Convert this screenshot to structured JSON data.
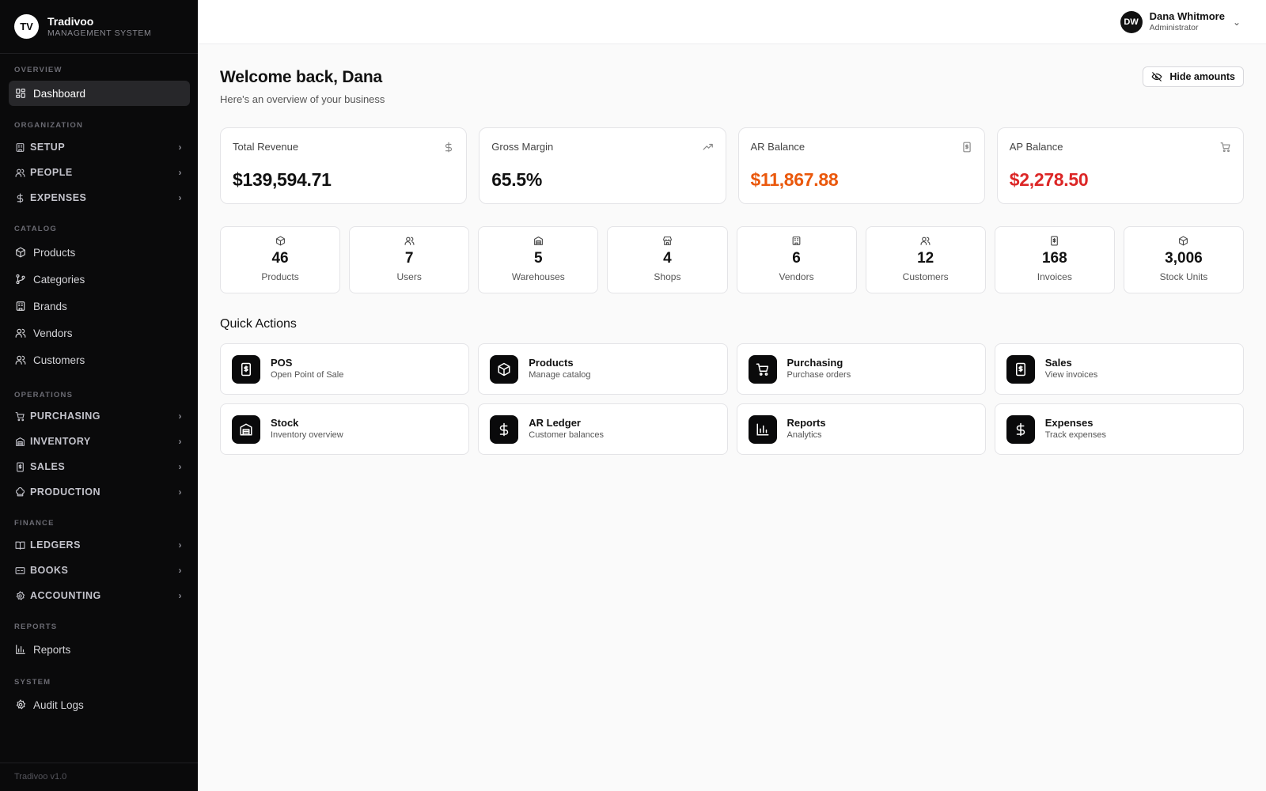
{
  "brand": {
    "logo": "TV",
    "name": "Tradivoo",
    "subtitle": "MANAGEMENT SYSTEM",
    "version": "Tradivoo v1.0"
  },
  "sidebar": {
    "sections": [
      "OVERVIEW",
      "ORGANIZATION",
      "CATALOG",
      "OPERATIONS",
      "FINANCE",
      "REPORTS",
      "SYSTEM"
    ],
    "items": [
      {
        "label": "Dashboard",
        "icon": "grid-icon"
      },
      {
        "label": "SETUP",
        "icon": "building-icon"
      },
      {
        "label": "PEOPLE",
        "icon": "users-icon"
      },
      {
        "label": "EXPENSES",
        "icon": "dollar-icon"
      },
      {
        "label": "Products",
        "icon": "box-icon"
      },
      {
        "label": "Categories",
        "icon": "branch-icon"
      },
      {
        "label": "Brands",
        "icon": "building-icon"
      },
      {
        "label": "Vendors",
        "icon": "users-icon"
      },
      {
        "label": "Customers",
        "icon": "users-icon"
      },
      {
        "label": "PURCHASING",
        "icon": "cart-icon"
      },
      {
        "label": "INVENTORY",
        "icon": "warehouse-icon"
      },
      {
        "label": "SALES",
        "icon": "receipt-icon"
      },
      {
        "label": "PRODUCTION",
        "icon": "chef-hat-icon"
      },
      {
        "label": "LEDGERS",
        "icon": "book-icon"
      },
      {
        "label": "BOOKS",
        "icon": "card-icon"
      },
      {
        "label": "ACCOUNTING",
        "icon": "gear-icon"
      },
      {
        "label": "Reports",
        "icon": "bar-chart-icon"
      },
      {
        "label": "Audit Logs",
        "icon": "gear-icon"
      }
    ]
  },
  "user": {
    "initials": "DW",
    "name": "Dana Whitmore",
    "role": "Administrator"
  },
  "header": {
    "welcome": "Welcome back, Dana",
    "subtitle": "Here's an overview of your business",
    "hide_amounts": "Hide amounts"
  },
  "kpis": [
    {
      "label": "Total Revenue",
      "value": "$139,594.71",
      "icon": "dollar-icon"
    },
    {
      "label": "Gross Margin",
      "value": "65.5%",
      "icon": "trending-up-icon"
    },
    {
      "label": "AR Balance",
      "value": "$11,867.88",
      "icon": "receipt-icon",
      "color": "#ea580c"
    },
    {
      "label": "AP Balance",
      "value": "$2,278.50",
      "icon": "cart-icon",
      "color": "#dc2626"
    }
  ],
  "stats": [
    {
      "value": "46",
      "label": "Products",
      "icon": "box-icon"
    },
    {
      "value": "7",
      "label": "Users",
      "icon": "users-icon"
    },
    {
      "value": "5",
      "label": "Warehouses",
      "icon": "warehouse-icon"
    },
    {
      "value": "4",
      "label": "Shops",
      "icon": "store-icon"
    },
    {
      "value": "6",
      "label": "Vendors",
      "icon": "building-icon"
    },
    {
      "value": "12",
      "label": "Customers",
      "icon": "users-icon"
    },
    {
      "value": "168",
      "label": "Invoices",
      "icon": "receipt-icon"
    },
    {
      "value": "3,006",
      "label": "Stock Units",
      "icon": "box-icon"
    }
  ],
  "quick_actions": {
    "title": "Quick Actions",
    "items": [
      {
        "name": "POS",
        "desc": "Open Point of Sale",
        "icon": "receipt-icon"
      },
      {
        "name": "Products",
        "desc": "Manage catalog",
        "icon": "box-icon"
      },
      {
        "name": "Purchasing",
        "desc": "Purchase orders",
        "icon": "cart-icon"
      },
      {
        "name": "Sales",
        "desc": "View invoices",
        "icon": "receipt-icon"
      },
      {
        "name": "Stock",
        "desc": "Inventory overview",
        "icon": "warehouse-icon"
      },
      {
        "name": "AR Ledger",
        "desc": "Customer balances",
        "icon": "dollar-icon"
      },
      {
        "name": "Reports",
        "desc": "Analytics",
        "icon": "bar-chart-icon"
      },
      {
        "name": "Expenses",
        "desc": "Track expenses",
        "icon": "dollar-icon"
      }
    ]
  },
  "colors": {
    "sidebar_bg": "#0a0a0b",
    "accent": "#111111",
    "ar_color": "#ea580c",
    "ap_color": "#dc2626"
  }
}
